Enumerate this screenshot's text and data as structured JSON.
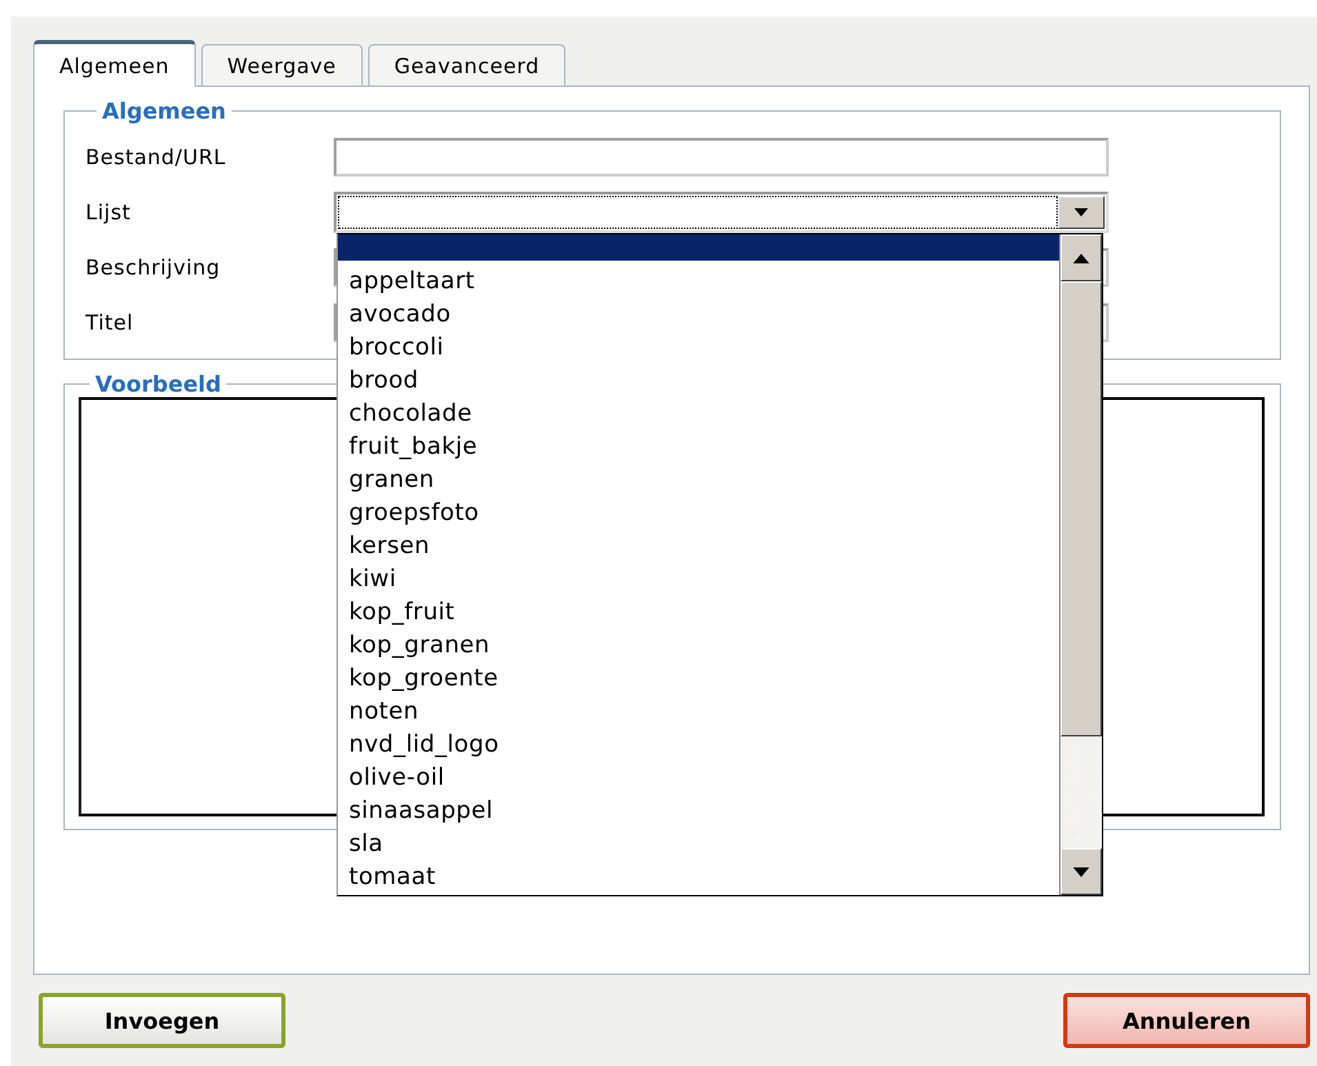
{
  "tabs": [
    {
      "label": "Algemeen",
      "selected": true
    },
    {
      "label": "Weergave",
      "selected": false
    },
    {
      "label": "Geavanceerd",
      "selected": false
    }
  ],
  "general": {
    "legend": "Algemeen",
    "fields": [
      {
        "kind": "text",
        "label": "Bestand/URL"
      },
      {
        "kind": "select",
        "label": "Lijst",
        "open": true
      },
      {
        "kind": "text",
        "label": "Beschrijving"
      },
      {
        "kind": "text",
        "label": "Titel"
      }
    ]
  },
  "dropdown_options": [
    {
      "selected": true
    },
    {
      "label": "appeltaart",
      "selected": false
    },
    {
      "label": "avocado",
      "selected": false
    },
    {
      "label": "broccoli",
      "selected": false
    },
    {
      "label": "brood",
      "selected": false
    },
    {
      "label": "chocolade",
      "selected": false
    },
    {
      "label": "fruit_bakje",
      "selected": false
    },
    {
      "label": "granen",
      "selected": false
    },
    {
      "label": "groepsfoto",
      "selected": false
    },
    {
      "label": "kersen",
      "selected": false
    },
    {
      "label": "kiwi",
      "selected": false
    },
    {
      "label": "kop_fruit",
      "selected": false
    },
    {
      "label": "kop_granen",
      "selected": false
    },
    {
      "label": "kop_groente",
      "selected": false
    },
    {
      "label": "noten",
      "selected": false
    },
    {
      "label": "nvd_lid_logo",
      "selected": false
    },
    {
      "label": "olive-oil",
      "selected": false
    },
    {
      "label": "sinaasappel",
      "selected": false
    },
    {
      "label": "sla",
      "selected": false
    },
    {
      "label": "tomaat",
      "selected": false
    }
  ],
  "preview": {
    "legend": "Voorbeeld"
  },
  "buttons": [
    {
      "kind": "insert",
      "label": "Invoegen"
    },
    {
      "kind": "cancel",
      "label": "Annuleren"
    }
  ]
}
